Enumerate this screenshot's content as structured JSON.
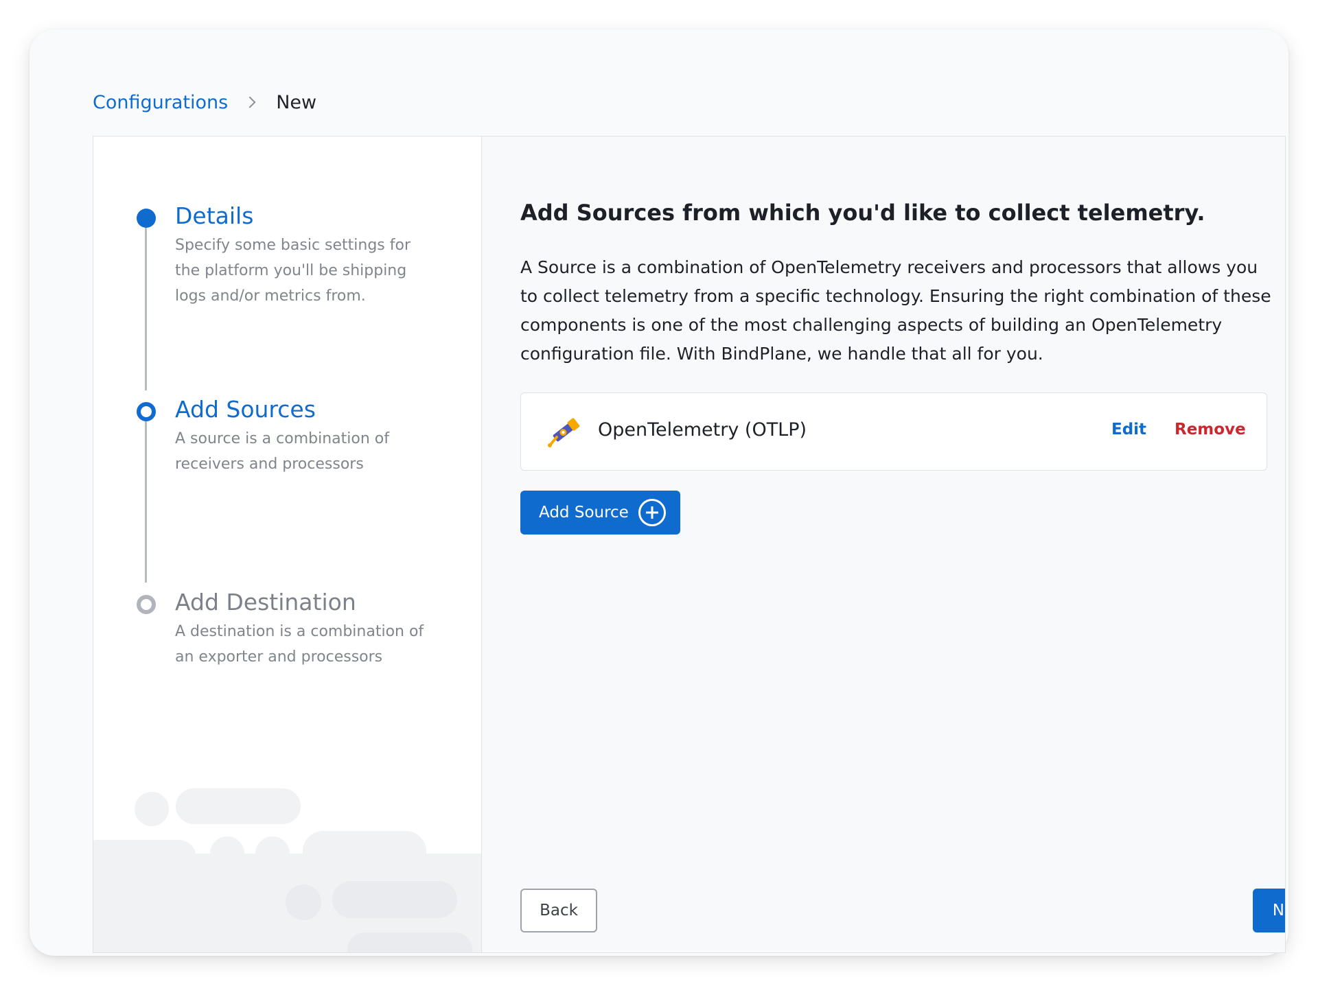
{
  "breadcrumb": {
    "parent": "Configurations",
    "current": "New"
  },
  "steps": [
    {
      "title": "Details",
      "description": "Specify some basic settings for the platform you'll be shipping logs and/or metrics from.",
      "state": "completed"
    },
    {
      "title": "Add Sources",
      "description": "A source is a combination of receivers and processors",
      "state": "active"
    },
    {
      "title": "Add Destination",
      "description": "A destination is a combination of an exporter and processors",
      "state": "inactive"
    }
  ],
  "main": {
    "heading": "Add Sources from which you'd like to collect telemetry.",
    "description": "A Source is a combination of OpenTelemetry receivers and processors that allows you to collect telemetry from a specific technology. Ensuring the right combination of these components is one of the most challenging aspects of building an OpenTelemetry configuration file. With BindPlane, we handle that all for you.",
    "sources": [
      {
        "name": "OpenTelemetry (OTLP)",
        "icon": "opentelemetry-telescope-icon",
        "edit_label": "Edit",
        "remove_label": "Remove"
      }
    ],
    "add_source_label": "Add Source"
  },
  "footer": {
    "back_label": "Back",
    "next_label": "Next"
  },
  "colors": {
    "accent": "#0f6bce",
    "danger": "#c8282e",
    "inactive": "#b1b5bb"
  }
}
